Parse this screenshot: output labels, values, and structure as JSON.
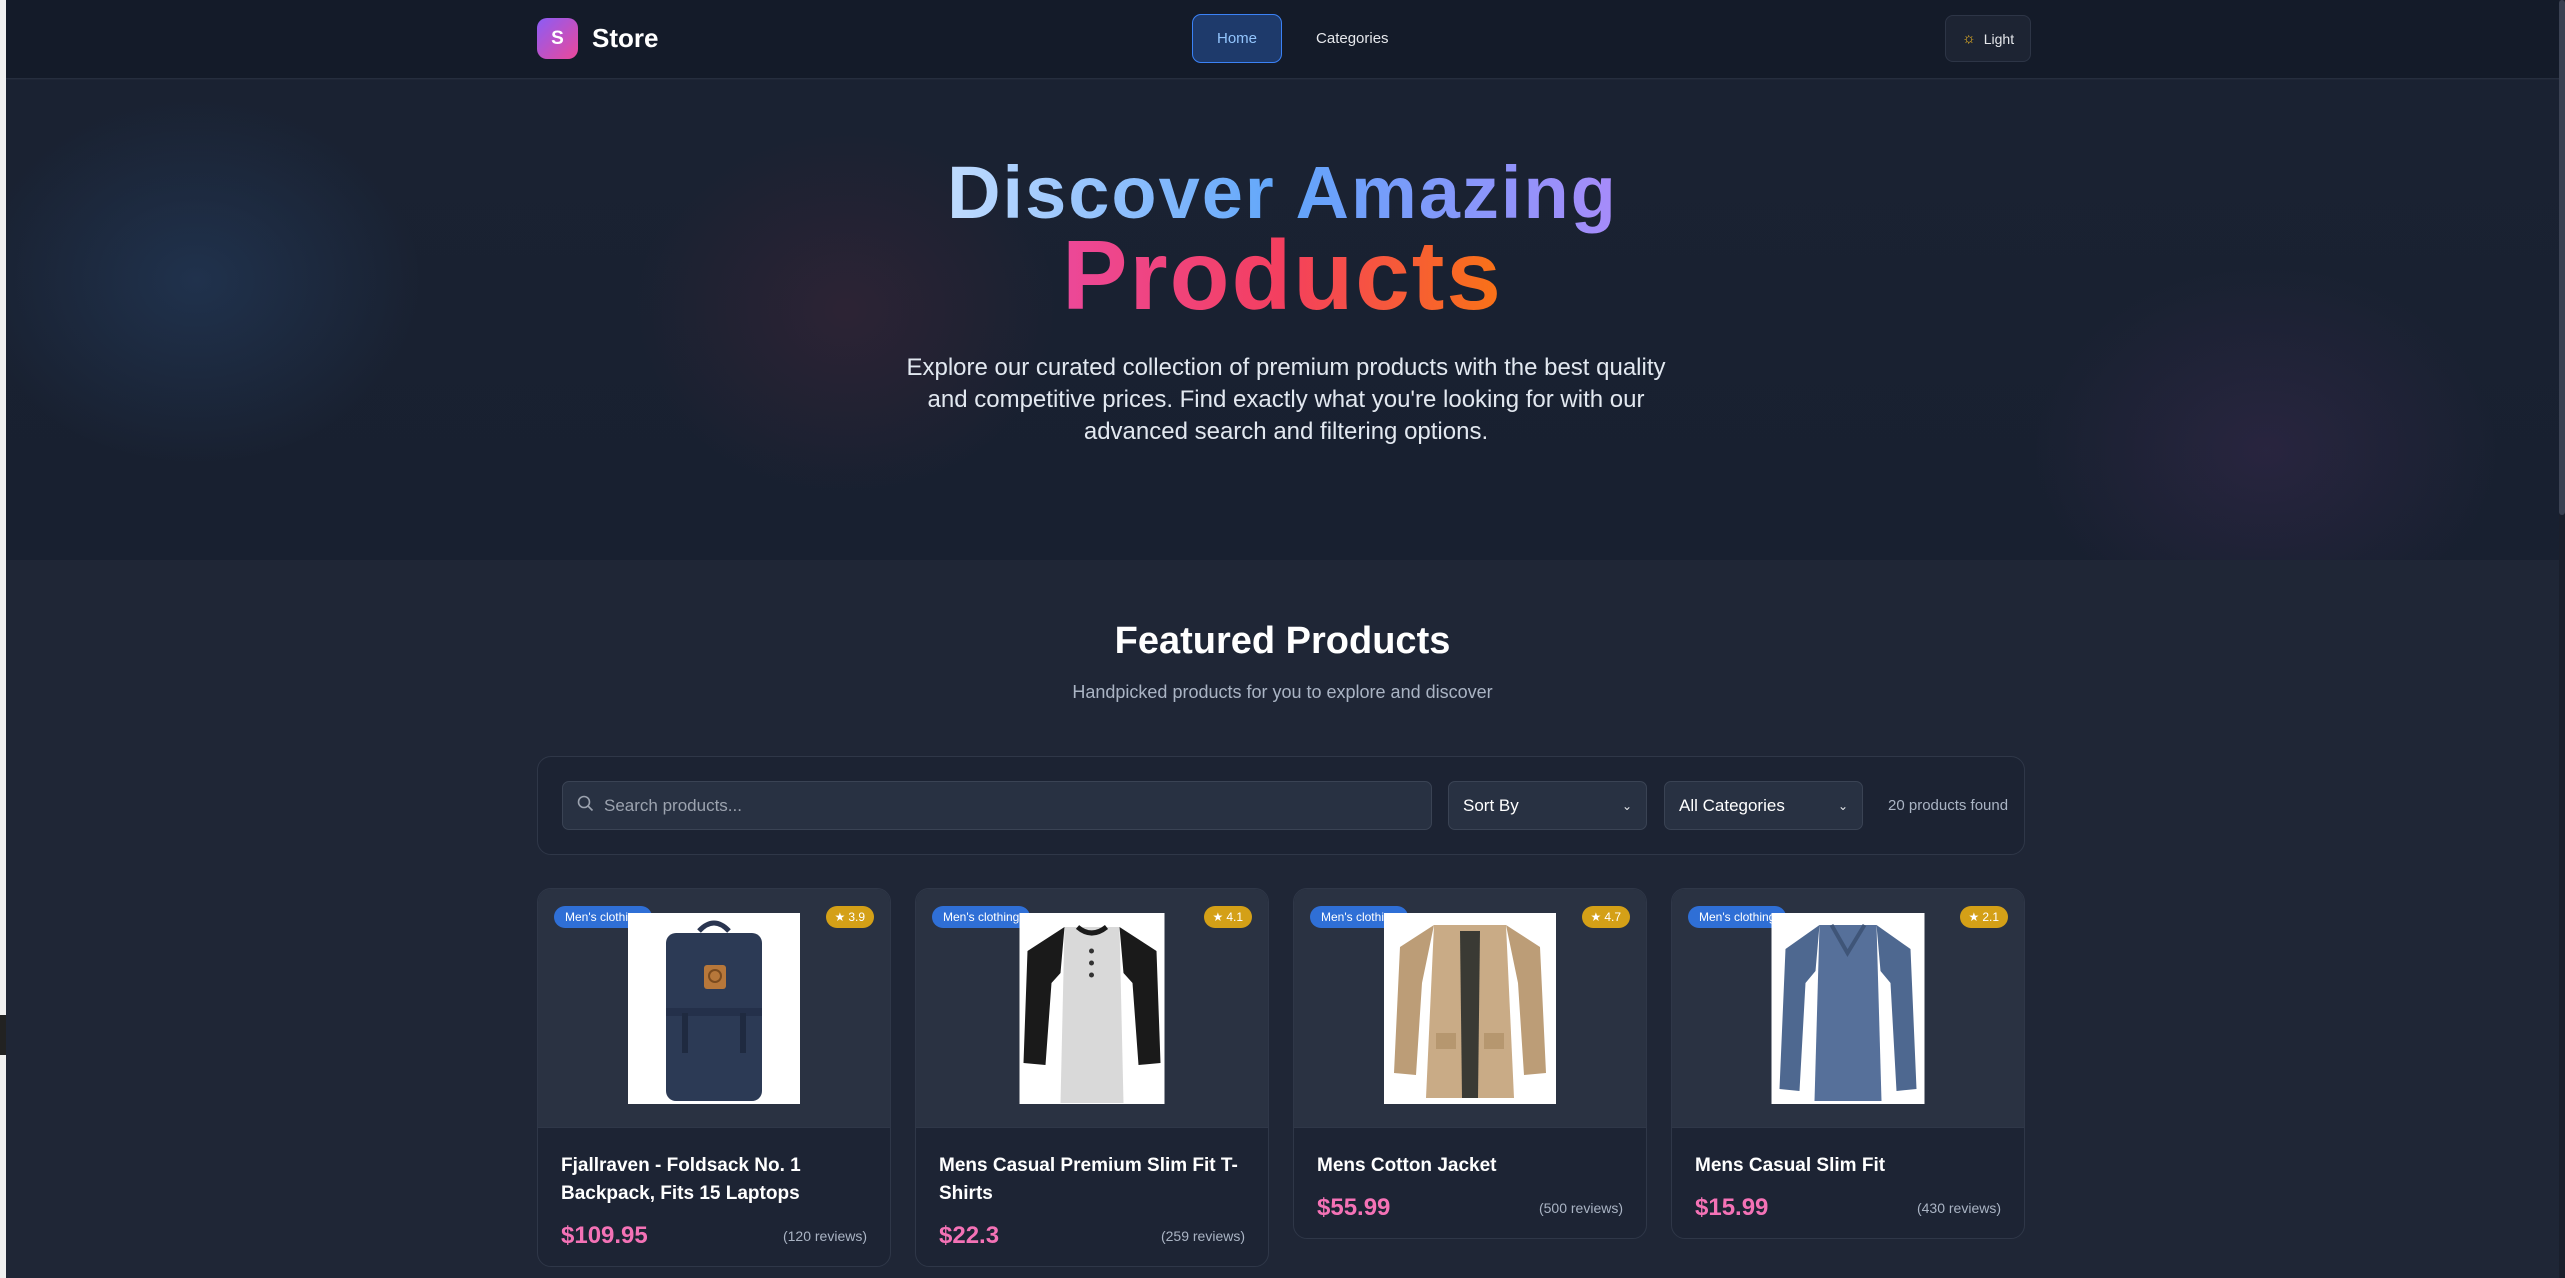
{
  "header": {
    "logo_letter": "S",
    "brand": "Store",
    "nav": [
      {
        "label": "Home",
        "active": true
      },
      {
        "label": "Categories",
        "active": false
      }
    ],
    "theme_toggle": {
      "label": "Light",
      "icon": "sun-icon"
    }
  },
  "hero": {
    "title_line1": "Discover Amazing",
    "title_line2": "Products",
    "description": "Explore our curated collection of premium products with the best quality and competitive prices. Find exactly what you're looking for with our advanced search and filtering options."
  },
  "featured": {
    "title": "Featured Products",
    "subtitle": "Handpicked products for you to explore and discover"
  },
  "filters": {
    "search_placeholder": "Search products...",
    "sort_label": "Sort By",
    "category_label": "All Categories",
    "results_count": "20 products found"
  },
  "products": [
    {
      "category": "Men's clothing",
      "rating": "3.9",
      "title": "Fjallraven - Foldsack No. 1 Backpack, Fits 15 Laptops",
      "price": "$109.95",
      "reviews": "(120 reviews)",
      "image": "backpack"
    },
    {
      "category": "Men's clothing",
      "rating": "4.1",
      "title": "Mens Casual Premium Slim Fit T-Shirts",
      "price": "$22.3",
      "reviews": "(259 reviews)",
      "image": "raglan-tshirt"
    },
    {
      "category": "Men's clothing",
      "rating": "4.7",
      "title": "Mens Cotton Jacket",
      "price": "$55.99",
      "reviews": "(500 reviews)",
      "image": "cotton-jacket"
    },
    {
      "category": "Men's clothing",
      "rating": "2.1",
      "title": "Mens Casual Slim Fit",
      "price": "$15.99",
      "reviews": "(430 reviews)",
      "image": "longsleeve-shirt"
    }
  ],
  "colors": {
    "accent": "#3b82f6",
    "price": "#f472b6",
    "rating_badge": "#d4a017",
    "category_badge": "#2f6fd6"
  }
}
